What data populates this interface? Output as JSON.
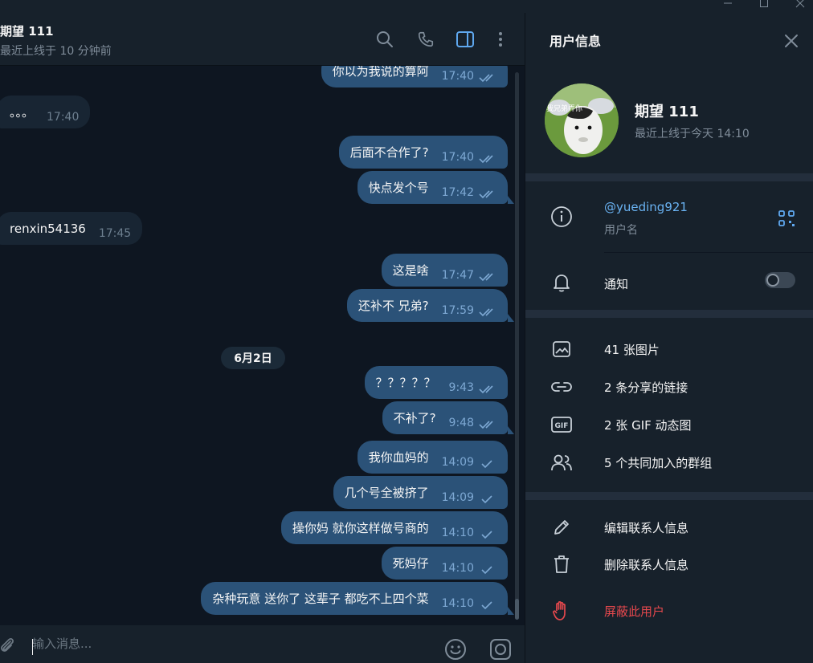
{
  "chat": {
    "name": "期望 111",
    "status": "最近上线于 10 分钟前",
    "icons": [
      "search-icon",
      "phone-icon",
      "sidebar-toggle-icon",
      "more-vertical-icon"
    ]
  },
  "messages": [
    {
      "dir": "out",
      "text": "你以为我说的算阿",
      "time": "17:40",
      "check": "double"
    },
    {
      "dir": "in",
      "text": "。。。",
      "time": "17:40"
    },
    {
      "dir": "out",
      "text": "后面不合作了?",
      "time": "17:40",
      "check": "double"
    },
    {
      "dir": "out",
      "text": "快点发个号",
      "time": "17:42",
      "check": "double"
    },
    {
      "dir": "in",
      "text": "renxin54136",
      "time": "17:45"
    },
    {
      "dir": "out",
      "text": "这是啥",
      "time": "17:47",
      "check": "double"
    },
    {
      "dir": "out",
      "text": "还补不 兄弟?",
      "time": "17:59",
      "check": "double"
    },
    {
      "dir": "out",
      "text": "？？？？？",
      "time": "9:43",
      "check": "double"
    },
    {
      "dir": "out",
      "text": "不补了?",
      "time": "9:48",
      "check": "double"
    },
    {
      "dir": "out",
      "text": "我你血妈的",
      "time": "14:09",
      "check": "single"
    },
    {
      "dir": "out",
      "text": "几个号全被挤了",
      "time": "14:09",
      "check": "single"
    },
    {
      "dir": "out",
      "text": "操你妈 就你这样做号商的",
      "time": "14:10",
      "check": "single"
    },
    {
      "dir": "out",
      "text": "死妈仔",
      "time": "14:10",
      "check": "single"
    },
    {
      "dir": "out",
      "text": "杂种玩意 送你了 这辈子 都吃不上四个菜",
      "time": "14:10",
      "check": "single"
    }
  ],
  "date_divider": "6月2日",
  "composer": {
    "placeholder": "输入消息...",
    "icons": [
      "attach-icon",
      "emoji-icon",
      "camera-icon"
    ]
  },
  "panel": {
    "title": "用户信息",
    "avatar_caption": "我兄弟弄你",
    "name": "期望 111",
    "status": "最近上线于今天 14:10",
    "username": "@yueding921",
    "username_label": "用户名",
    "notifications": "通知",
    "notifications_on": false,
    "media": [
      {
        "icon": "image-icon",
        "label": "41 张图片"
      },
      {
        "icon": "link-icon",
        "label": "2 条分享的链接"
      },
      {
        "icon": "gif-icon",
        "label": "2 张 GIF 动态图"
      },
      {
        "icon": "group-icon",
        "label": "5 个共同加入的群组"
      }
    ],
    "actions": [
      {
        "icon": "edit-icon",
        "label": "编辑联系人信息"
      },
      {
        "icon": "trash-icon",
        "label": "删除联系人信息"
      },
      {
        "icon": "block-hand-icon",
        "label": "屏蔽此用户"
      }
    ]
  },
  "colors": {
    "bg": "#0e1621",
    "panel": "#17212b",
    "bubble_out": "#2b5278",
    "bubble_in": "#182533",
    "accent": "#6ab3f3",
    "danger": "#e5484d"
  }
}
